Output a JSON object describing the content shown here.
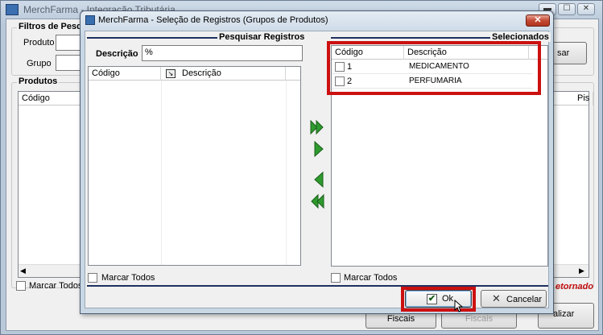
{
  "main_window": {
    "title": "MerchFarma - Integração Tributária",
    "filters_group": "Filtros de Pesqu",
    "produto_label": "Produto",
    "grupo_label": "Grupo",
    "pesquisar_fragment": "sar",
    "produtos_group": "Produtos",
    "produtos_columns": [
      "Código",
      "Pis"
    ],
    "marcar_todos": "Marcar Todos",
    "retornado_fragment": "etornado",
    "fiscais_label": "Fiscais",
    "fiscais_disabled_label": "Fiscais",
    "atualizar_fragment": "alizar",
    "controls": {
      "minimize": "▬",
      "maximize": "☐",
      "close": "✕"
    }
  },
  "dialog": {
    "title": "MerchFarma - Seleção de Registros (Grupos de Produtos)",
    "close_label": "✕",
    "left": {
      "section_title": "Pesquisar Registros",
      "descricao_label": "Descrição",
      "descricao_value": "%",
      "columns": [
        "Código",
        "Descrição"
      ],
      "sort_icon": "sort-icon",
      "marcar_todos": "Marcar Todos"
    },
    "right": {
      "section_title": "Selecionados",
      "columns": [
        "Código",
        "Descrição"
      ],
      "rows": [
        {
          "codigo": "1",
          "descricao": "MEDICAMENTO",
          "checked": false
        },
        {
          "codigo": "2",
          "descricao": "PERFUMARIA",
          "checked": false
        }
      ],
      "marcar_todos": "Marcar Todos"
    },
    "transfer_buttons": [
      "add-all-icon",
      "add-one-icon",
      "remove-one-icon",
      "remove-all-icon"
    ],
    "ok_label": "Ok",
    "cancel_label": "Cancelar",
    "highlight_color": "#cc1010",
    "arrow_color": "#2e9a2e"
  }
}
